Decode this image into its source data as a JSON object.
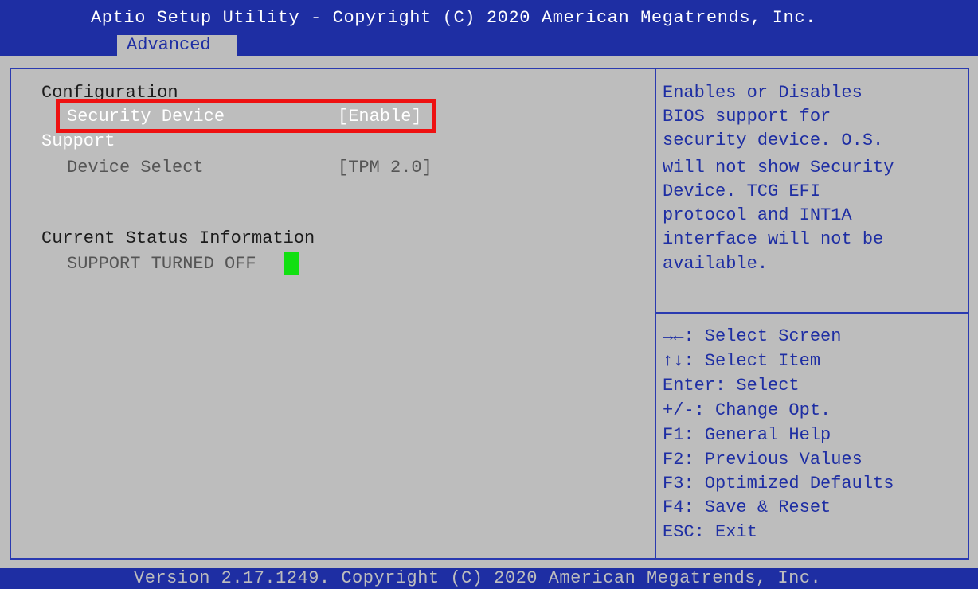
{
  "header": {
    "title": "Aptio Setup Utility - Copyright (C) 2020 American Megatrends, Inc.",
    "active_tab": "Advanced"
  },
  "main": {
    "section_configuration": "Configuration",
    "security_device": {
      "label": "Security Device",
      "value": "[Enable]"
    },
    "support_label": "Support",
    "device_select": {
      "label": "Device Select",
      "value": "[TPM 2.0]"
    },
    "section_status": "Current Status Information",
    "status_text": "SUPPORT TURNED OFF"
  },
  "help": {
    "description_lines": [
      "Enables or Disables",
      "BIOS support for",
      "security device. O.S.",
      "will not show Security",
      "Device. TCG EFI",
      "protocol and INT1A",
      "interface will not be",
      "available."
    ],
    "keys": [
      "→←: Select Screen",
      "↑↓: Select Item",
      "Enter: Select",
      "+/-: Change Opt.",
      "F1: General Help",
      "F2: Previous Values",
      "F3: Optimized Defaults",
      "F4: Save & Reset",
      "ESC: Exit"
    ]
  },
  "footer": {
    "text": "Version 2.17.1249. Copyright (C) 2020 American Megatrends, Inc."
  },
  "colors": {
    "background": "#bdbdbd",
    "header_blue": "#1e2ea3",
    "highlight_outline": "#ee1111",
    "cursor_green": "#11e011"
  }
}
